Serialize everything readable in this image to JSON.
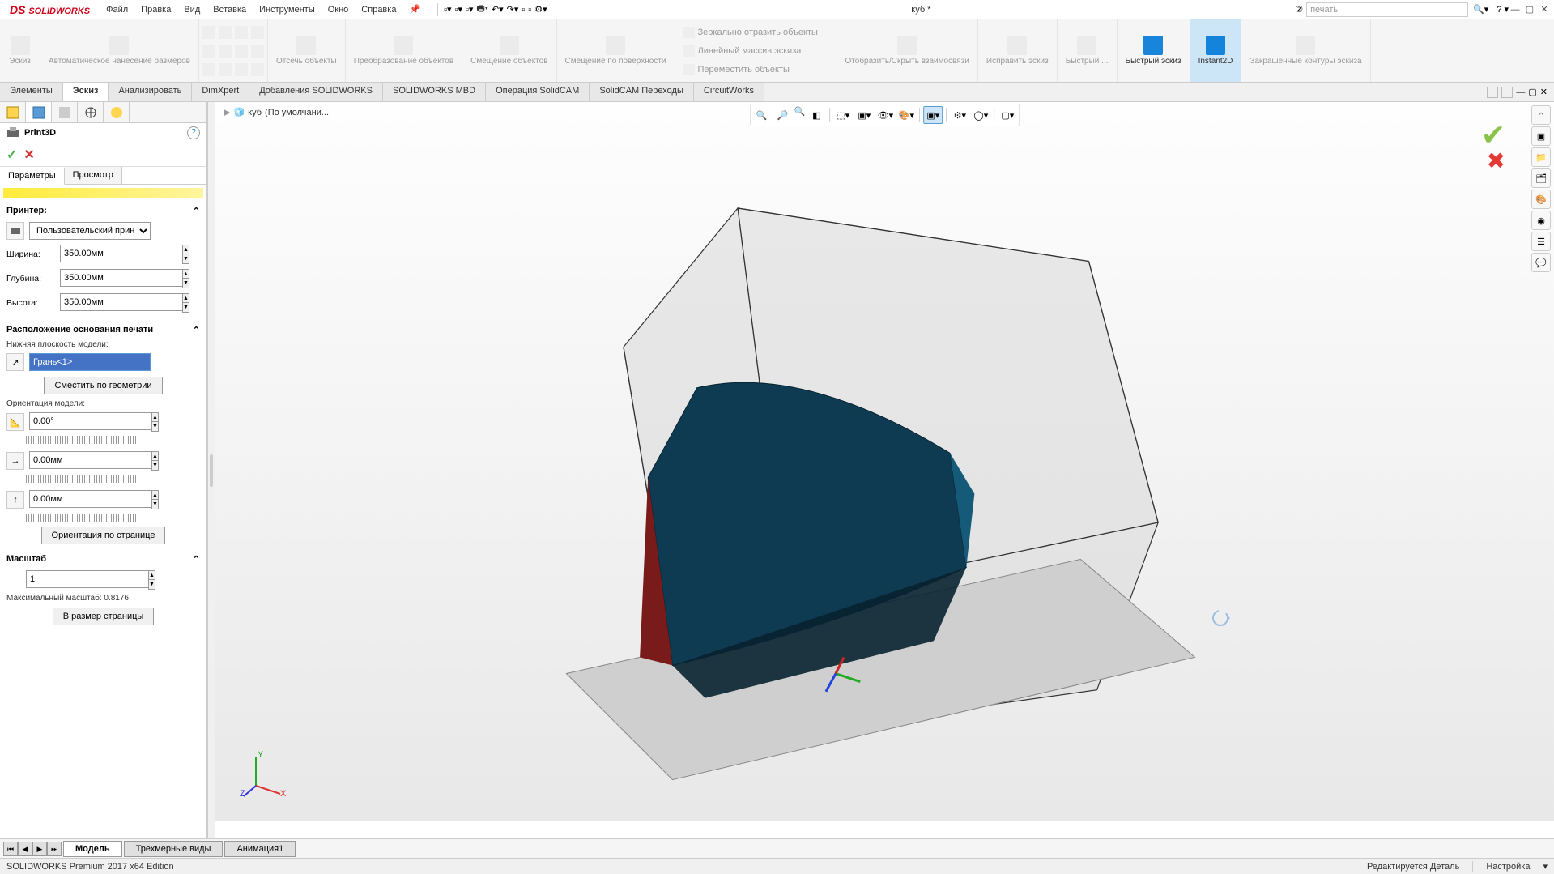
{
  "menubar": {
    "logo": "SOLIDWORKS",
    "items": [
      "Файл",
      "Правка",
      "Вид",
      "Вставка",
      "Инструменты",
      "Окно",
      "Справка"
    ],
    "doc_title": "куб *",
    "search_placeholder": "печать"
  },
  "ribbon": {
    "buttons": [
      {
        "label": "Эскиз"
      },
      {
        "label": "Автоматическое нанесение размеров"
      },
      {
        "label": "Отсечь объекты"
      },
      {
        "label": "Преобразование объектов"
      },
      {
        "label": "Смещение объектов"
      },
      {
        "label": "Смещение по поверхности"
      },
      {
        "label": "Зеркально отразить объекты"
      },
      {
        "label": "Линейный массив эскиза"
      },
      {
        "label": "Переместить объекты"
      },
      {
        "label": "Отобразить/Скрыть взаимосвязи"
      },
      {
        "label": "Исправить эскиз"
      },
      {
        "label": "Быстрый ..."
      },
      {
        "label": "Быстрый эскиз",
        "enabled": true
      },
      {
        "label": "Instant2D",
        "active": true
      },
      {
        "label": "Закрашенные контуры эскиза"
      }
    ]
  },
  "tabs": {
    "items": [
      "Элементы",
      "Эскиз",
      "Анализировать",
      "DimXpert",
      "Добавления SOLIDWORKS",
      "SOLIDWORKS MBD",
      "Операция  SolidCAM",
      "SolidCAM Переходы",
      "CircuitWorks"
    ],
    "active": 1
  },
  "viewport": {
    "breadcrumb_doc": "куб",
    "breadcrumb_config": "(По умолчани..."
  },
  "panel": {
    "title": "Print3D",
    "subtabs": {
      "params": "Параметры",
      "preview": "Просмотр",
      "active": "params"
    },
    "printer": {
      "section_title": "Принтер:",
      "selected": "Пользовательский прин"
    },
    "dimensions": {
      "width_label": "Ширина:",
      "depth_label": "Глубина:",
      "height_label": "Высота:",
      "width": "350.00мм",
      "depth": "350.00мм",
      "height": "350.00мм"
    },
    "print_base": {
      "section_title": "Расположение основания печати",
      "bottom_face_label": "Нижняя плоскость модели:",
      "selected_face": "Грань<1>",
      "offset_btn": "Сместить по геометрии"
    },
    "orientation": {
      "label": "Ориентация модели:",
      "angle": "0.00°",
      "dx": "0.00мм",
      "dy": "0.00мм",
      "page_orient_btn": "Ориентация по странице"
    },
    "scale": {
      "section_title": "Масштаб",
      "value": "1",
      "max_label": "Максимальный масштаб: 0.8176",
      "fit_btn": "В размер страницы"
    }
  },
  "bottom_tabs": {
    "items": [
      "Модель",
      "Трехмерные виды",
      "Анимация1"
    ],
    "active": 0
  },
  "statusbar": {
    "left": "SOLIDWORKS Premium 2017 x64 Edition",
    "mode": "Редактируется Деталь",
    "custom": "Настройка"
  }
}
